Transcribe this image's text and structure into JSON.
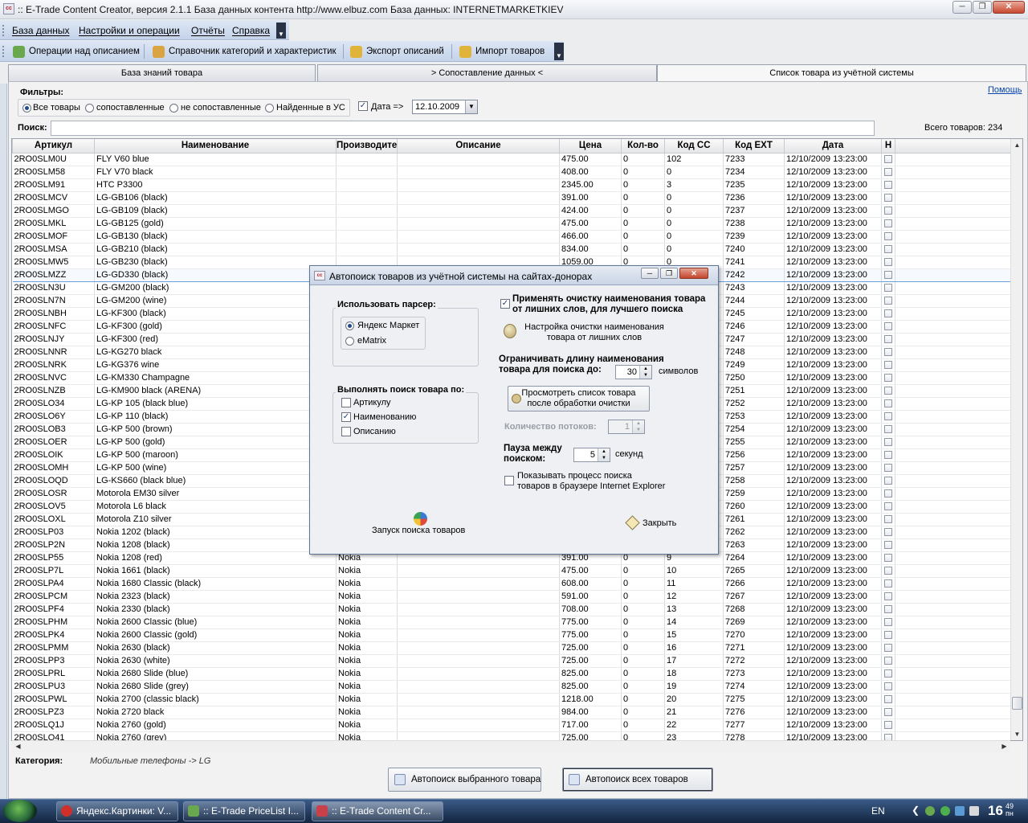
{
  "window": {
    "title": ":: E-Trade Content Creator, версия 2.1.1     База данных контента     http://www.elbuz.com     База данных: INTERNETMARKETKIEV",
    "icon_text": "cc"
  },
  "menu": [
    "База данных",
    "Настройки и операции",
    "Отчёты",
    "Справка"
  ],
  "toolbar": [
    {
      "label": "Операции над описанием",
      "icon": "operations-icon",
      "color": "#6aa84f"
    },
    {
      "label": "Справочник категорий и характеристик",
      "icon": "catalog-icon",
      "color": "#d9a441"
    },
    {
      "label": "Экспорт описаний",
      "icon": "export-icon",
      "color": "#e0b43a"
    },
    {
      "label": "Импорт товаров",
      "icon": "import-icon",
      "color": "#e0b43a"
    }
  ],
  "tabs": [
    "База знаний товара",
    "> Сопоставление данных <",
    "Список товара из учётной системы"
  ],
  "help": "Помощь",
  "filters": {
    "title": "Фильтры:",
    "options": [
      "Все товары",
      "сопоставленные",
      "не сопоставленные",
      "Найденные в УС"
    ],
    "selected": 0,
    "date_label": "Дата =>",
    "date_checked": true,
    "date_value": "12.10.2009"
  },
  "search": {
    "label": "Поиск:",
    "value": ""
  },
  "total": "Всего товаров: 234",
  "grid": {
    "columns": [
      "Артикул",
      "Наименование",
      "Производите",
      "Описание",
      "Цена",
      "Кол-во",
      "Код СС",
      "Код EXT",
      "Дата",
      "Н"
    ],
    "rows": [
      [
        "2RO0SLM0U",
        "FLY V60 blue",
        "",
        "",
        "475.00",
        "0",
        "102",
        "7233",
        "12/10/2009 13:23:00"
      ],
      [
        "2RO0SLM58",
        "FLY V70 black",
        "",
        "",
        "408.00",
        "0",
        "0",
        "7234",
        "12/10/2009 13:23:00"
      ],
      [
        "2RO0SLM91",
        "HTC P3300",
        "",
        "",
        "2345.00",
        "0",
        "3",
        "7235",
        "12/10/2009 13:23:00"
      ],
      [
        "2RO0SLMCV",
        "LG-GB106 (black)",
        "",
        "",
        "391.00",
        "0",
        "0",
        "7236",
        "12/10/2009 13:23:00"
      ],
      [
        "2RO0SLMGO",
        "LG-GB109 (black)",
        "",
        "",
        "424.00",
        "0",
        "0",
        "7237",
        "12/10/2009 13:23:00"
      ],
      [
        "2RO0SLMKL",
        "LG-GB125 (gold)",
        "",
        "",
        "475.00",
        "0",
        "0",
        "7238",
        "12/10/2009 13:23:00"
      ],
      [
        "2RO0SLMOF",
        "LG-GB130 (black)",
        "",
        "",
        "466.00",
        "0",
        "0",
        "7239",
        "12/10/2009 13:23:00"
      ],
      [
        "2RO0SLMSA",
        "LG-GB210 (black)",
        "",
        "",
        "834.00",
        "0",
        "0",
        "7240",
        "12/10/2009 13:23:00"
      ],
      [
        "2RO0SLMW5",
        "LG-GB230 (black)",
        "",
        "",
        "1059.00",
        "0",
        "0",
        "7241",
        "12/10/2009 13:23:00"
      ],
      [
        "2RO0SLMZZ",
        "LG-GD330 (black)",
        "",
        "",
        "",
        "",
        "",
        "7242",
        "12/10/2009 13:23:00"
      ],
      [
        "2RO0SLN3U",
        "LG-GM200 (black)",
        "",
        "",
        "",
        "",
        "",
        "7243",
        "12/10/2009 13:23:00"
      ],
      [
        "2RO0SLN7N",
        "LG-GM200 (wine)",
        "",
        "",
        "",
        "",
        "",
        "7244",
        "12/10/2009 13:23:00"
      ],
      [
        "2RO0SLNBH",
        "LG-KF300 (black)",
        "",
        "",
        "",
        "",
        "",
        "7245",
        "12/10/2009 13:23:00"
      ],
      [
        "2RO0SLNFC",
        "LG-KF300 (gold)",
        "",
        "",
        "",
        "",
        "",
        "7246",
        "12/10/2009 13:23:00"
      ],
      [
        "2RO0SLNJY",
        "LG-KF300 (red)",
        "",
        "",
        "",
        "",
        "",
        "7247",
        "12/10/2009 13:23:00"
      ],
      [
        "2RO0SLNNR",
        "LG-KG270 black",
        "",
        "",
        "",
        "",
        "",
        "7248",
        "12/10/2009 13:23:00"
      ],
      [
        "2RO0SLNRK",
        "LG-KG376 wine",
        "",
        "",
        "",
        "",
        "",
        "7249",
        "12/10/2009 13:23:00"
      ],
      [
        "2RO0SLNVC",
        "LG-KM330 Champagne",
        "",
        "",
        "",
        "",
        "",
        "7250",
        "12/10/2009 13:23:00"
      ],
      [
        "2RO0SLNZB",
        "LG-KM900 black (ARENA)",
        "",
        "",
        "",
        "",
        "",
        "7251",
        "12/10/2009 13:23:00"
      ],
      [
        "2RO0SLO34",
        "LG-KP 105 (black blue)",
        "",
        "",
        "",
        "",
        "",
        "7252",
        "12/10/2009 13:23:00"
      ],
      [
        "2RO0SLO6Y",
        "LG-KP 110 (black)",
        "",
        "",
        "",
        "",
        "",
        "7253",
        "12/10/2009 13:23:00"
      ],
      [
        "2RO0SLOB3",
        "LG-KP 500 (brown)",
        "",
        "",
        "",
        "",
        "",
        "7254",
        "12/10/2009 13:23:00"
      ],
      [
        "2RO0SLOER",
        "LG-KP 500 (gold)",
        "",
        "",
        "",
        "",
        "",
        "7255",
        "12/10/2009 13:23:00"
      ],
      [
        "2RO0SLOIK",
        "LG-KP 500 (maroon)",
        "",
        "",
        "",
        "",
        "",
        "7256",
        "12/10/2009 13:23:00"
      ],
      [
        "2RO0SLOMH",
        "LG-KP 500 (wine)",
        "",
        "",
        "",
        "",
        "",
        "7257",
        "12/10/2009 13:23:00"
      ],
      [
        "2RO0SLOQD",
        "LG-KS660 (black blue)",
        "",
        "",
        "",
        "",
        "",
        "7258",
        "12/10/2009 13:23:00"
      ],
      [
        "2RO0SLOSR",
        "Motorola EM30 silver",
        "",
        "",
        "",
        "",
        "",
        "7259",
        "12/10/2009 13:23:00"
      ],
      [
        "2RO0SLOV5",
        "Motorola L6 black",
        "",
        "",
        "",
        "",
        "",
        "7260",
        "12/10/2009 13:23:00"
      ],
      [
        "2RO0SLOXL",
        "Motorola Z10 silver",
        "",
        "",
        "",
        "",
        "",
        "7261",
        "12/10/2009 13:23:00"
      ],
      [
        "2RO0SLP03",
        "Nokia 1202 (black)",
        "",
        "",
        "",
        "",
        "",
        "7262",
        "12/10/2009 13:23:00"
      ],
      [
        "2RO0SLP2N",
        "Nokia 1208 (black)",
        "",
        "",
        "",
        "",
        "",
        "7263",
        "12/10/2009 13:23:00"
      ],
      [
        "2RO0SLP55",
        "Nokia 1208 (red)",
        "Nokia",
        "",
        "391.00",
        "0",
        "9",
        "7264",
        "12/10/2009 13:23:00"
      ],
      [
        "2RO0SLP7L",
        "Nokia 1661 (black)",
        "Nokia",
        "",
        "475.00",
        "0",
        "10",
        "7265",
        "12/10/2009 13:23:00"
      ],
      [
        "2RO0SLPA4",
        "Nokia 1680 Classic (black)",
        "Nokia",
        "",
        "608.00",
        "0",
        "11",
        "7266",
        "12/10/2009 13:23:00"
      ],
      [
        "2RO0SLPCM",
        "Nokia 2323 (black)",
        "Nokia",
        "",
        "591.00",
        "0",
        "12",
        "7267",
        "12/10/2009 13:23:00"
      ],
      [
        "2RO0SLPF4",
        "Nokia 2330 (black)",
        "Nokia",
        "",
        "708.00",
        "0",
        "13",
        "7268",
        "12/10/2009 13:23:00"
      ],
      [
        "2RO0SLPHM",
        "Nokia 2600 Classic (blue)",
        "Nokia",
        "",
        "775.00",
        "0",
        "14",
        "7269",
        "12/10/2009 13:23:00"
      ],
      [
        "2RO0SLPK4",
        "Nokia 2600 Classic (gold)",
        "Nokia",
        "",
        "775.00",
        "0",
        "15",
        "7270",
        "12/10/2009 13:23:00"
      ],
      [
        "2RO0SLPMM",
        "Nokia 2630 (black)",
        "Nokia",
        "",
        "725.00",
        "0",
        "16",
        "7271",
        "12/10/2009 13:23:00"
      ],
      [
        "2RO0SLPP3",
        "Nokia 2630 (white)",
        "Nokia",
        "",
        "725.00",
        "0",
        "17",
        "7272",
        "12/10/2009 13:23:00"
      ],
      [
        "2RO0SLPRL",
        "Nokia 2680 Slide (blue)",
        "Nokia",
        "",
        "825.00",
        "0",
        "18",
        "7273",
        "12/10/2009 13:23:00"
      ],
      [
        "2RO0SLPU3",
        "Nokia 2680 Slide (grey)",
        "Nokia",
        "",
        "825.00",
        "0",
        "19",
        "7274",
        "12/10/2009 13:23:00"
      ],
      [
        "2RO0SLPWL",
        "Nokia 2700 (classic black)",
        "Nokia",
        "",
        "1218.00",
        "0",
        "20",
        "7275",
        "12/10/2009 13:23:00"
      ],
      [
        "2RO0SLPZ3",
        "Nokia 2720 black",
        "Nokia",
        "",
        "984.00",
        "0",
        "21",
        "7276",
        "12/10/2009 13:23:00"
      ],
      [
        "2RO0SLQ1J",
        "Nokia 2760 (gold)",
        "Nokia",
        "",
        "717.00",
        "0",
        "22",
        "7277",
        "12/10/2009 13:23:00"
      ],
      [
        "2RO0SLQ41",
        "Nokia 2760 (grey)",
        "Nokia",
        "",
        "725.00",
        "0",
        "23",
        "7278",
        "12/10/2009 13:23:00"
      ]
    ],
    "selected_row": 9
  },
  "category": {
    "label": "Категория:",
    "value": "Мобильные телефоны -> LG"
  },
  "bottom_buttons": [
    "Автопоиск выбранного товара",
    "Автопоиск всех товаров"
  ],
  "dialog": {
    "title": "Автопоиск товаров из учётной системы на сайтах-донорах",
    "parser": {
      "title": "Использовать парсер:",
      "options": [
        "Яндекс Маркет",
        "eMatrix"
      ],
      "selected": 0
    },
    "search_by": {
      "title": "Выполнять поиск товара по:",
      "options": [
        {
          "label": "Артикулу",
          "checked": false
        },
        {
          "label": "Наименованию",
          "checked": true
        },
        {
          "label": "Описанию",
          "checked": false
        }
      ]
    },
    "clean_names": {
      "label1": "Применять очистку наименования товара",
      "label2": "от лишних слов, для лучшего поиска",
      "checked": true
    },
    "clean_settings": {
      "line1": "Настройка очистки наименования",
      "line2": "товара от лишних слов"
    },
    "limit": {
      "line1": "Ограничивать длину наименования",
      "line2": "товара для поиска до:",
      "value": "30",
      "unit": "символов"
    },
    "preview_btn": {
      "line1": "Просмотреть список товара",
      "line2": "после обработки очистки"
    },
    "threads": {
      "label": "Количество потоков:",
      "value": "1"
    },
    "pause": {
      "line1": "Пауза между",
      "line2": "поиском:",
      "value": "5",
      "unit": "секунд"
    },
    "show_ie": {
      "line1": "Показывать процесс поиска",
      "line2": "товаров в браузере Internet Explorer",
      "checked": false
    },
    "start_label": "Запуск поиска товаров",
    "close_label": "Закрыть"
  },
  "taskbar": {
    "items": [
      {
        "label": "Яндекс.Картинки: V...",
        "color": "#d0302c"
      },
      {
        "label": ":: E-Trade PriceList I...",
        "color": "#6aa84f"
      },
      {
        "label": ":: E-Trade Content Cr...",
        "color": "#c8404a"
      }
    ],
    "active": 2,
    "lang": "EN",
    "time": "16",
    "time_minutes": "49",
    "day": "пн"
  }
}
